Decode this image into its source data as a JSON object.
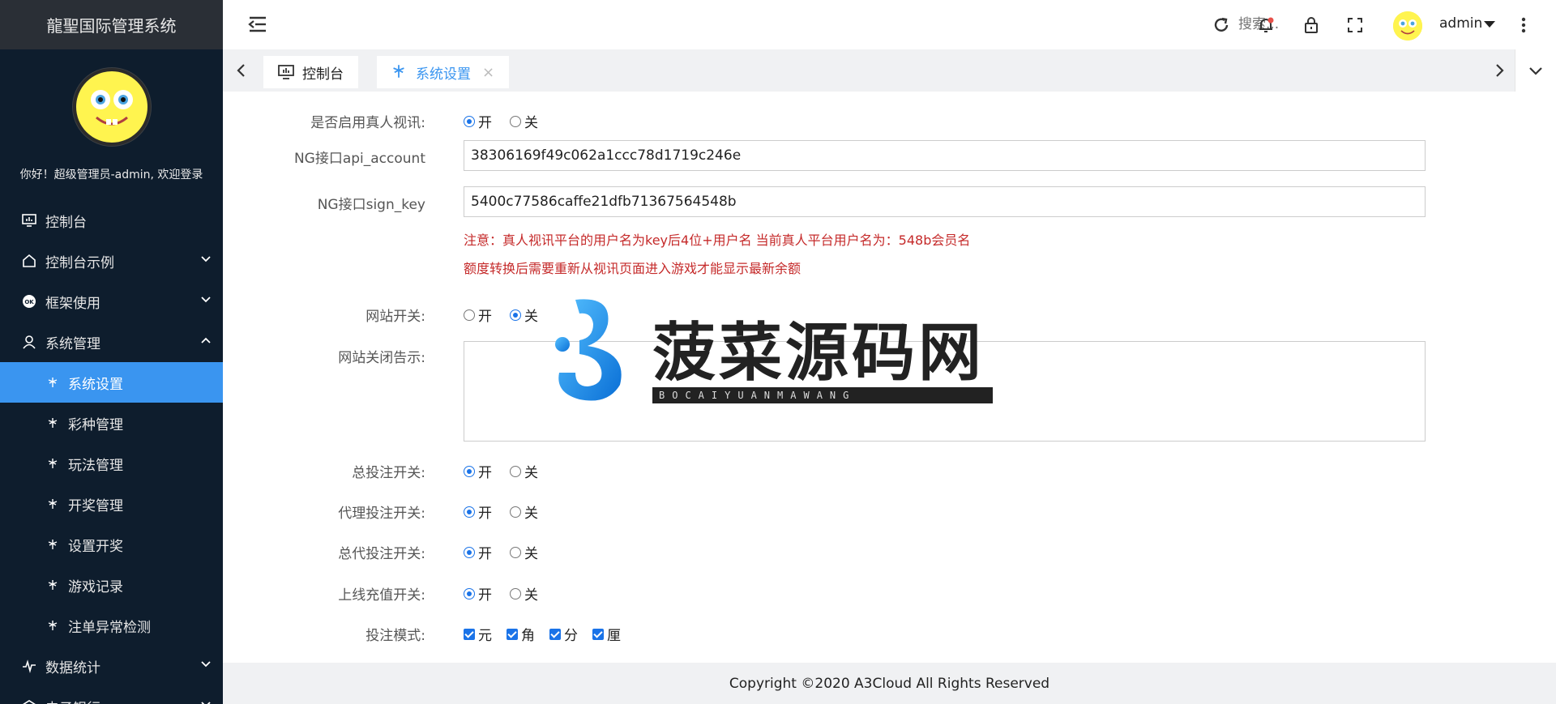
{
  "brand": {
    "title": "龍聖国际管理系统"
  },
  "sidebar": {
    "welcome": "你好！超级管理员-admin, 欢迎登录",
    "items": [
      {
        "label": "控制台"
      },
      {
        "label": "控制台示例"
      },
      {
        "label": "框架使用"
      },
      {
        "label": "系统管理"
      }
    ],
    "subitems": [
      {
        "label": "系统设置"
      },
      {
        "label": "彩种管理"
      },
      {
        "label": "玩法管理"
      },
      {
        "label": "开奖管理"
      },
      {
        "label": "设置开奖"
      },
      {
        "label": "游戏记录"
      },
      {
        "label": "注单异常检测"
      }
    ],
    "bottom_items": [
      {
        "label": "数据统计"
      },
      {
        "label": "电子银行"
      }
    ]
  },
  "header": {
    "search_placeholder": "搜索...",
    "username": "admin"
  },
  "tabs": [
    {
      "label": "控制台"
    },
    {
      "label": "系统设置",
      "close": "×"
    }
  ],
  "form": {
    "live_video": {
      "label": "是否启用真人视讯:",
      "on": "开",
      "off": "关",
      "selected": "on"
    },
    "api_account": {
      "label": "NG接口api_account",
      "value": "38306169f49c062a1ccc78d1719c246e"
    },
    "sign_key": {
      "label": "NG接口sign_key",
      "value": "5400c77586caffe21dfb71367564548b"
    },
    "note1": "注意：真人视讯平台的用户名为key后4位+用户名 当前真人平台用户名为：548b会员名",
    "note2": "额度转换后需要重新从视讯页面进入游戏才能显示最新余额",
    "site_switch": {
      "label": "网站开关:",
      "on": "开",
      "off": "关",
      "selected": "off"
    },
    "site_close_msg": {
      "label": "网站关闭告示:"
    },
    "total_bet": {
      "label": "总投注开关:",
      "on": "开",
      "off": "关",
      "selected": "on"
    },
    "agent_bet": {
      "label": "代理投注开关:",
      "on": "开",
      "off": "关",
      "selected": "on"
    },
    "general_agent_bet": {
      "label": "总代投注开关:",
      "on": "开",
      "off": "关",
      "selected": "on"
    },
    "online_recharge": {
      "label": "上线充值开关:",
      "on": "开",
      "off": "关",
      "selected": "on"
    },
    "bet_mode": {
      "label": "投注模式:",
      "options": [
        "元",
        "角",
        "分",
        "厘"
      ]
    }
  },
  "watermark": {
    "title": "菠菜源码网",
    "subtitle": "BOCAIYUANMAWANG"
  },
  "footer": {
    "copyright": "Copyright ©2020 A3Cloud All Rights Reserved"
  },
  "colors": {
    "sidebar_bg": "#0e1d2d",
    "active_blue": "#3a95f0",
    "note_red": "#c52a2a"
  }
}
